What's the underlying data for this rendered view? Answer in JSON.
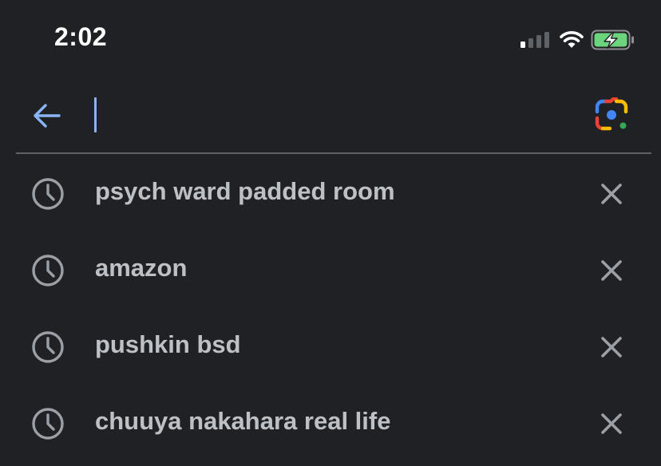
{
  "status_bar": {
    "time": "2:02",
    "signal_icon": "cellular-signal-icon",
    "wifi_icon": "wifi-icon",
    "battery_icon": "battery-charging-icon"
  },
  "search": {
    "back_icon": "arrow-left-icon",
    "value": "",
    "placeholder": "",
    "lens_icon": "google-lens-icon"
  },
  "history": {
    "items": [
      {
        "label": "psych ward padded room",
        "icon": "history-clock-icon",
        "remove_icon": "close-icon"
      },
      {
        "label": "amazon",
        "icon": "history-clock-icon",
        "remove_icon": "close-icon"
      },
      {
        "label": "pushkin bsd",
        "icon": "history-clock-icon",
        "remove_icon": "close-icon"
      },
      {
        "label": "chuuya nakahara real life",
        "icon": "history-clock-icon",
        "remove_icon": "close-icon"
      }
    ]
  },
  "colors": {
    "background": "#202124",
    "text": "#bdc1c6",
    "icon": "#9aa0a6",
    "accent": "#8ab4f8",
    "battery_green": "#6dd47e"
  }
}
